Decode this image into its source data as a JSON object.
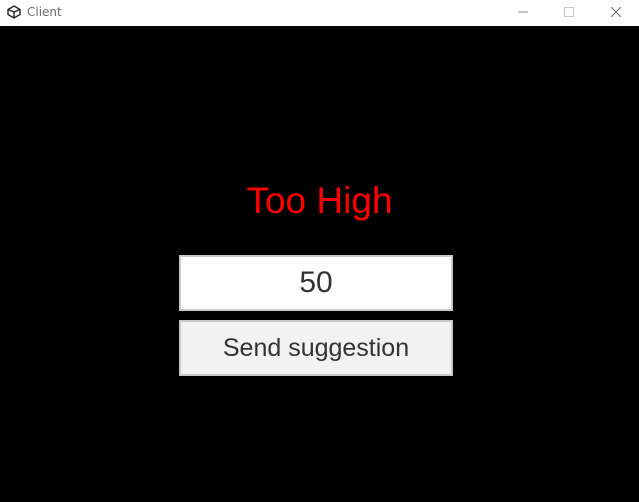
{
  "window": {
    "title": "Client",
    "controls": {
      "minimize": "minimize-icon",
      "maximize": "maximize-icon",
      "close": "close-icon"
    }
  },
  "game": {
    "status": "Too High",
    "status_color": "#ff0000",
    "guess_value": "50",
    "send_label": "Send suggestion"
  }
}
